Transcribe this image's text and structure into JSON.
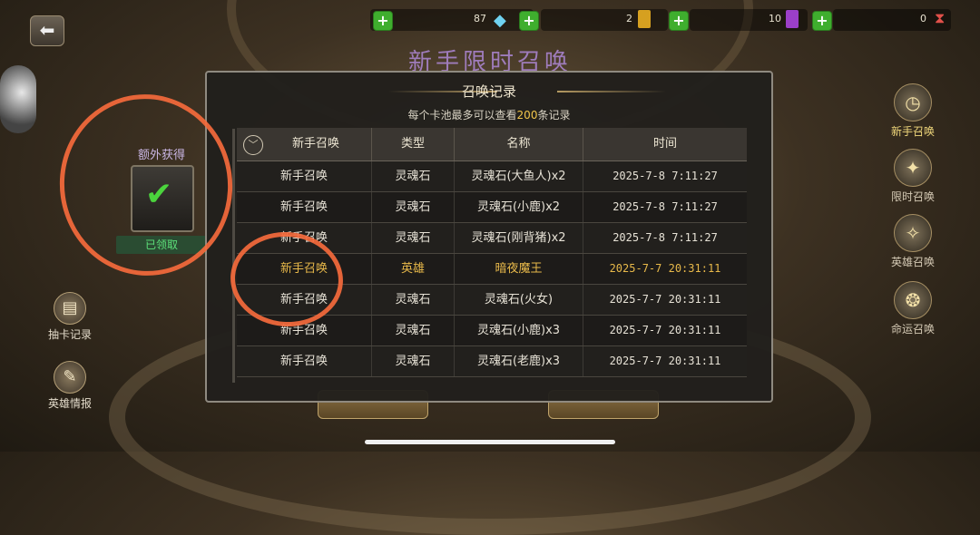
{
  "currencies": [
    {
      "value": "87",
      "icon": "diamond-icon"
    },
    {
      "value": "2",
      "icon": "gold-card-icon"
    },
    {
      "value": "10",
      "icon": "purple-card-icon"
    },
    {
      "value": "0",
      "icon": "hourglass-icon"
    }
  ],
  "banner_title": "新手限时召唤",
  "extra": {
    "title": "额外获得",
    "status": "已领取"
  },
  "left_menu": [
    {
      "label": "抽卡记录",
      "icon": "scroll-record-icon"
    },
    {
      "label": "英雄情报",
      "icon": "hero-info-icon"
    }
  ],
  "right_menu": [
    {
      "label": "新手召唤",
      "icon": "clock-icon",
      "active": true
    },
    {
      "label": "限时召唤",
      "icon": "emblem-icon"
    },
    {
      "label": "英雄召唤",
      "icon": "hero-emblem-icon"
    },
    {
      "label": "命运召唤",
      "icon": "fate-emblem-icon"
    }
  ],
  "modal": {
    "title": "召唤记录",
    "subtitle_pre": "每个卡池最多可以查看",
    "subtitle_num": "200",
    "subtitle_post": "条记录",
    "headers": [
      "新手召唤",
      "类型",
      "名称",
      "时间"
    ],
    "rows": [
      {
        "pool": "新手召唤",
        "type": "灵魂石",
        "name": "灵魂石(大鱼人)x2",
        "time": "2025-7-8  7:11:27",
        "hero": false
      },
      {
        "pool": "新手召唤",
        "type": "灵魂石",
        "name": "灵魂石(小鹿)x2",
        "time": "2025-7-8  7:11:27",
        "hero": false
      },
      {
        "pool": "新手召唤",
        "type": "灵魂石",
        "name": "灵魂石(刚背猪)x2",
        "time": "2025-7-8  7:11:27",
        "hero": false
      },
      {
        "pool": "新手召唤",
        "type": "英雄",
        "name": "暗夜魔王",
        "time": "2025-7-7  20:31:11",
        "hero": true
      },
      {
        "pool": "新手召唤",
        "type": "灵魂石",
        "name": "灵魂石(火女)",
        "time": "2025-7-7  20:31:11",
        "hero": false
      },
      {
        "pool": "新手召唤",
        "type": "灵魂石",
        "name": "灵魂石(小鹿)x3",
        "time": "2025-7-7  20:31:11",
        "hero": false
      },
      {
        "pool": "新手召唤",
        "type": "灵魂石",
        "name": "灵魂石(老鹿)x3",
        "time": "2025-7-7  20:31:11",
        "hero": false
      }
    ]
  },
  "colors": {
    "annotation": "#f56a3c",
    "highlight": "#f2c64b",
    "hero_row": "#e8b94a"
  }
}
